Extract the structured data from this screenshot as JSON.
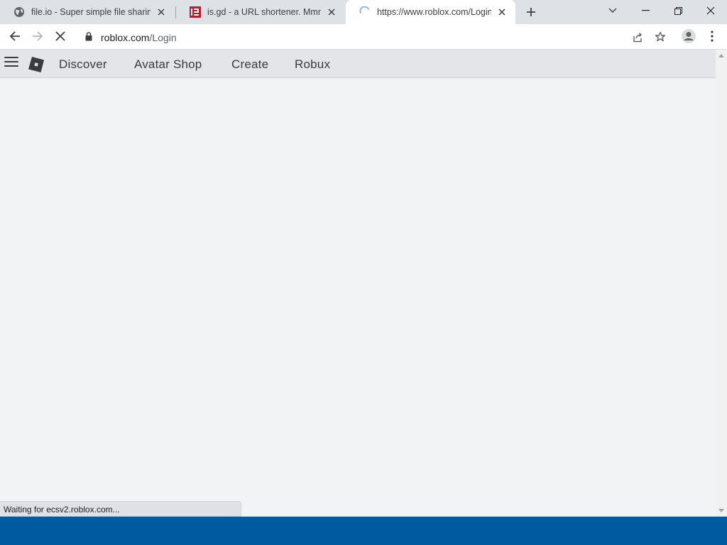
{
  "browser": {
    "tabs": [
      {
        "title": "file.io - Super simple file sharing",
        "favicon": "globe-icon",
        "active": false
      },
      {
        "title": "is.gd - a URL shortener. Mmmm, tasty URLs!",
        "favicon": "isgd-icon",
        "active": false
      },
      {
        "title": "https://www.roblox.com/Login",
        "favicon": "loading-spinner-icon",
        "active": true
      }
    ],
    "address": {
      "domain": "roblox.com",
      "path": "/Login"
    },
    "status_text": "Waiting for ecsv2.roblox.com..."
  },
  "site": {
    "nav_items": [
      "Discover",
      "Avatar Shop",
      "Create",
      "Robux"
    ]
  },
  "colors": {
    "tabstrip": "#dee1e6",
    "navbar": "#e3e5e8",
    "page_bg": "#f2f3f5",
    "taskbar": "#005a9e"
  }
}
